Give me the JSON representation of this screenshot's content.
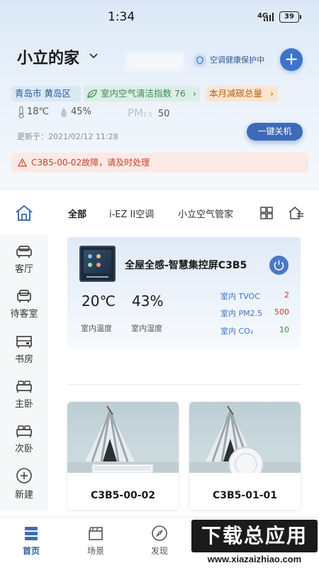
{
  "status_bar": {
    "time": "1:34",
    "network": "4G",
    "battery": "39"
  },
  "header": {
    "home_name": "小立的家",
    "health_status": "空调健康保护中",
    "add_label": "+"
  },
  "chips": {
    "location": "青岛市 黄岛区",
    "air_index": "室内空气清洁指数 76",
    "carbon": "本月减碳总量"
  },
  "weather": {
    "temperature": "18℃",
    "humidity": "45%",
    "pm_label": "PM",
    "pm_sub": "2.5",
    "pm_value": "50"
  },
  "updated_at": "更新于：2021/02/12 11:28",
  "one_click_off": "一键关机",
  "alert": "C3B5-00-02故障，请及时处理",
  "sidebar": {
    "items": [
      {
        "label": "",
        "icon": "home-icon"
      },
      {
        "label": "客厅",
        "icon": "sofa-icon"
      },
      {
        "label": "待客室",
        "icon": "armchair-icon"
      },
      {
        "label": "书房",
        "icon": "cabinet-icon"
      },
      {
        "label": "主卧",
        "icon": "bed-icon"
      },
      {
        "label": "次卧",
        "icon": "bed-icon"
      },
      {
        "label": "新建",
        "icon": "plus-circle-icon"
      }
    ]
  },
  "tabs": [
    {
      "label": "全部"
    },
    {
      "label": "i-EZ II空调"
    },
    {
      "label": "小立空气管家"
    }
  ],
  "device_card": {
    "name": "全屋全感-智慧集控屏C3B5",
    "temperature": "20℃",
    "humidity": "43%",
    "temperature_label": "室内温度",
    "humidity_label": "室内湿度",
    "metrics": [
      {
        "label": "室内 TVOC",
        "value": "2",
        "color": "#c4412f"
      },
      {
        "label": "室内 PM2.5",
        "value": "500",
        "color": "#c4412f"
      },
      {
        "label": "室内 CO₂",
        "value": "10",
        "color": "#3b8a3b"
      }
    ]
  },
  "products": [
    {
      "name": "C3B5-00-02"
    },
    {
      "name": "C3B5-01-01"
    }
  ],
  "bottom_nav": [
    {
      "label": "首页"
    },
    {
      "label": "场景"
    },
    {
      "label": "发现"
    }
  ],
  "watermark": {
    "main": "下载总应用",
    "url": "www.xiazaizhiao.com"
  }
}
